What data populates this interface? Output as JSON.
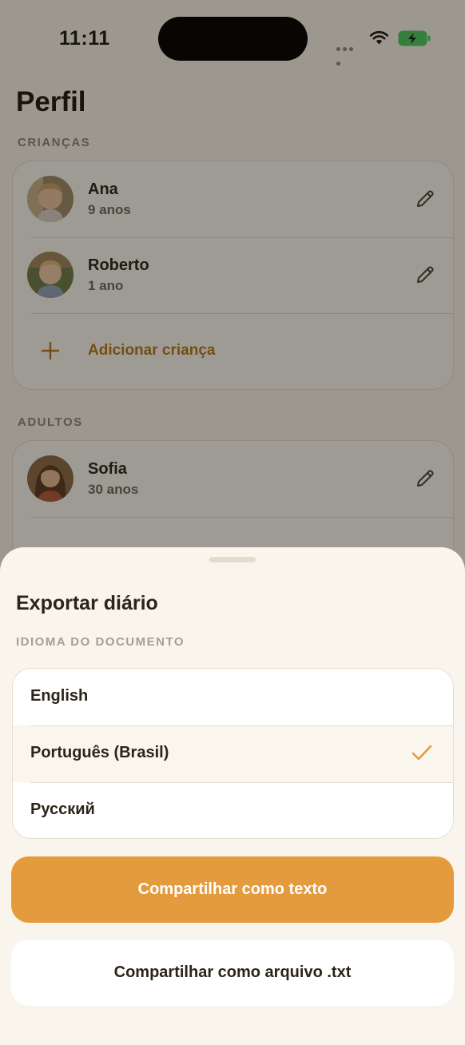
{
  "status_bar": {
    "time": "11:11"
  },
  "page": {
    "title": "Perfil",
    "children_section": {
      "header": "CRIANÇAS",
      "items": [
        {
          "name": "Ana",
          "age": "9 anos"
        },
        {
          "name": "Roberto",
          "age": "1 ano"
        }
      ],
      "add_label": "Adicionar criança"
    },
    "adults_section": {
      "header": "ADULTOS",
      "items": [
        {
          "name": "Sofia",
          "age": "30 anos"
        }
      ]
    }
  },
  "sheet": {
    "title": "Exportar diário",
    "section_header": "IDIOMA DO DOCUMENTO",
    "languages": [
      {
        "label": "English",
        "selected": false
      },
      {
        "label": "Português (Brasil)",
        "selected": true
      },
      {
        "label": "Русский",
        "selected": false
      }
    ],
    "primary_button": "Compartilhar como texto",
    "secondary_button": "Compartilhar como arquivo .txt"
  },
  "colors": {
    "accent": "#e49b3d",
    "link": "#b27a1c",
    "background": "#f7f3ea",
    "battery_green": "#4cc95e"
  },
  "icons": [
    "wifi-icon",
    "battery-charging-icon",
    "pencil-icon",
    "plus-icon",
    "checkmark-icon"
  ]
}
